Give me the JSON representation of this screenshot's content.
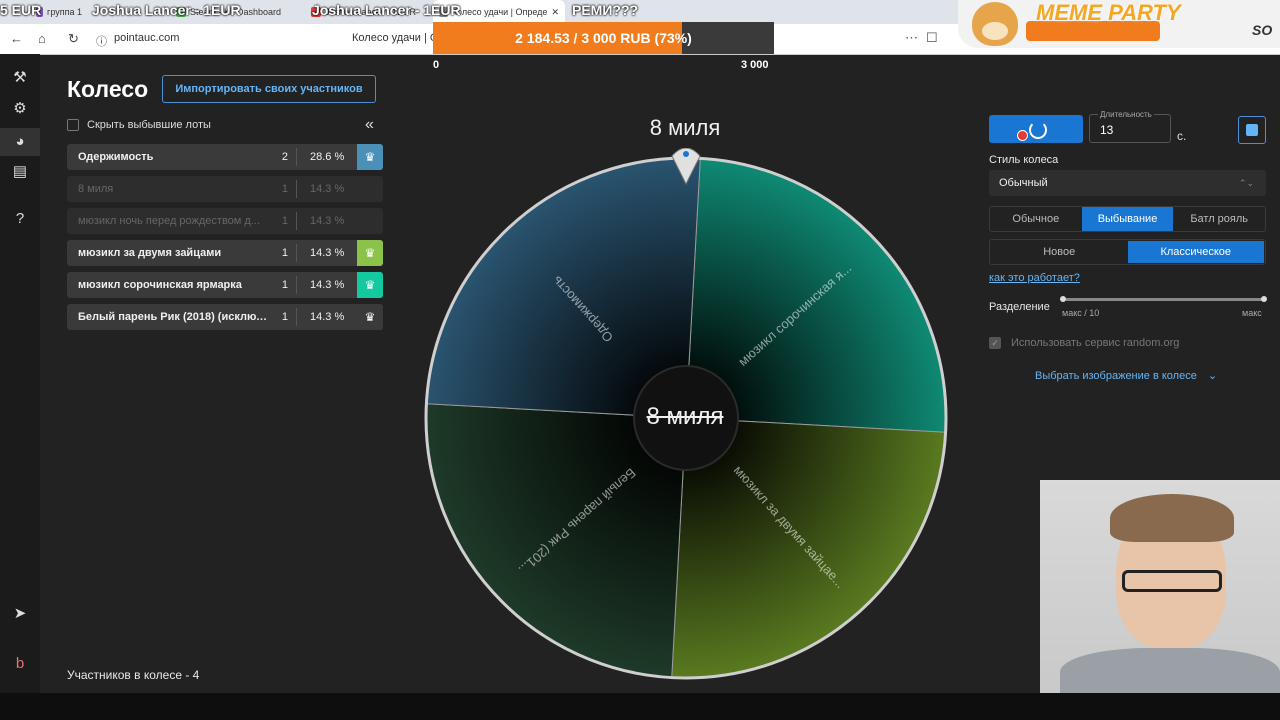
{
  "browser": {
    "tabs": [
      {
        "label": "группа 1",
        "fav": "#7e57c2"
      },
      {
        "label": "Steam - Kit Dashboard",
        "fav": "#4caf50"
      },
      {
        "label": "Joshua Lancer - 1EUR",
        "fav": "#e53935"
      },
      {
        "label": "Колесо удачи | Опреде",
        "fav": "#888888"
      }
    ],
    "overlay_texts": [
      "5 EUR",
      "Joshua Lancer - 1EUR",
      "Joshua Lancer - 1EUR",
      "РЕМИ???"
    ],
    "url": "pointauc.com",
    "page_title": "Колесо удачи | Ог"
  },
  "donation": {
    "text": "2 184.53 / 3 000 RUB (73%)",
    "progress": 0.73,
    "min": "0",
    "max": "3 000"
  },
  "meme": {
    "title": "MEME PARTY",
    "code": "SO"
  },
  "page": {
    "title": "Колесо",
    "import_button": "Импортировать своих участников",
    "hide_label": "Скрыть выбывшие лоты",
    "collapse": "«",
    "footer": "Участников в колесе - 4"
  },
  "lots": [
    {
      "name": "Одержимость",
      "count": "2",
      "percent": "28.6 %",
      "out": false,
      "color": "#4a90b8"
    },
    {
      "name": "8 миля",
      "count": "1",
      "percent": "14.3 %",
      "out": true,
      "color": ""
    },
    {
      "name": "мюзикл ночь перед рождеством д...",
      "count": "1",
      "percent": "14.3 %",
      "out": true,
      "color": ""
    },
    {
      "name": "мюзикл за двумя зайцами",
      "count": "1",
      "percent": "14.3 %",
      "out": false,
      "color": "#8bc34a"
    },
    {
      "name": "мюзикл сорочинская ярмарка",
      "count": "1",
      "percent": "14.3 %",
      "out": false,
      "color": "#14c9a0"
    },
    {
      "name": "Белый парень Рик (2018) (исключе...",
      "count": "1",
      "percent": "14.3 %",
      "out": false,
      "color": "#3a3a3a"
    }
  ],
  "wheel": {
    "winner_title": "8 миля",
    "center_label": "8 миля",
    "segments": [
      {
        "label": "мюзикл сорочинская я...",
        "share": 0.25,
        "color": "#0f8a74"
      },
      {
        "label": "мюзикл за двумя зайцаe...",
        "share": 0.25,
        "color": "#5a7a20"
      },
      {
        "label": "Белый парень Рик (201...",
        "share": 0.25,
        "color": "#1e3a28"
      },
      {
        "label": "Одержимость",
        "share": 0.25,
        "color": "#2a5470"
      }
    ]
  },
  "controls": {
    "duration_label": "Длительность",
    "duration_value": "13",
    "duration_unit": "с.",
    "style_label": "Стиль колеса",
    "style_value": "Обычный",
    "modes": [
      "Обычное",
      "Выбывание",
      "Батл рояль"
    ],
    "mode_selected": 1,
    "submodes": [
      "Новое",
      "Классическое"
    ],
    "submode_selected": 1,
    "how_link": "как это работает?",
    "split_label": "Разделение",
    "split_min": "макс / 10",
    "split_max": "макс",
    "random_org": "Использовать сервис random.org",
    "image_select": "Выбрать изображение в колесе"
  },
  "sidebar_icons": [
    "gavel-icon",
    "gear-icon",
    "wheel-icon",
    "clipboard-icon",
    "help-icon",
    "telegram-icon",
    "brand-icon"
  ]
}
